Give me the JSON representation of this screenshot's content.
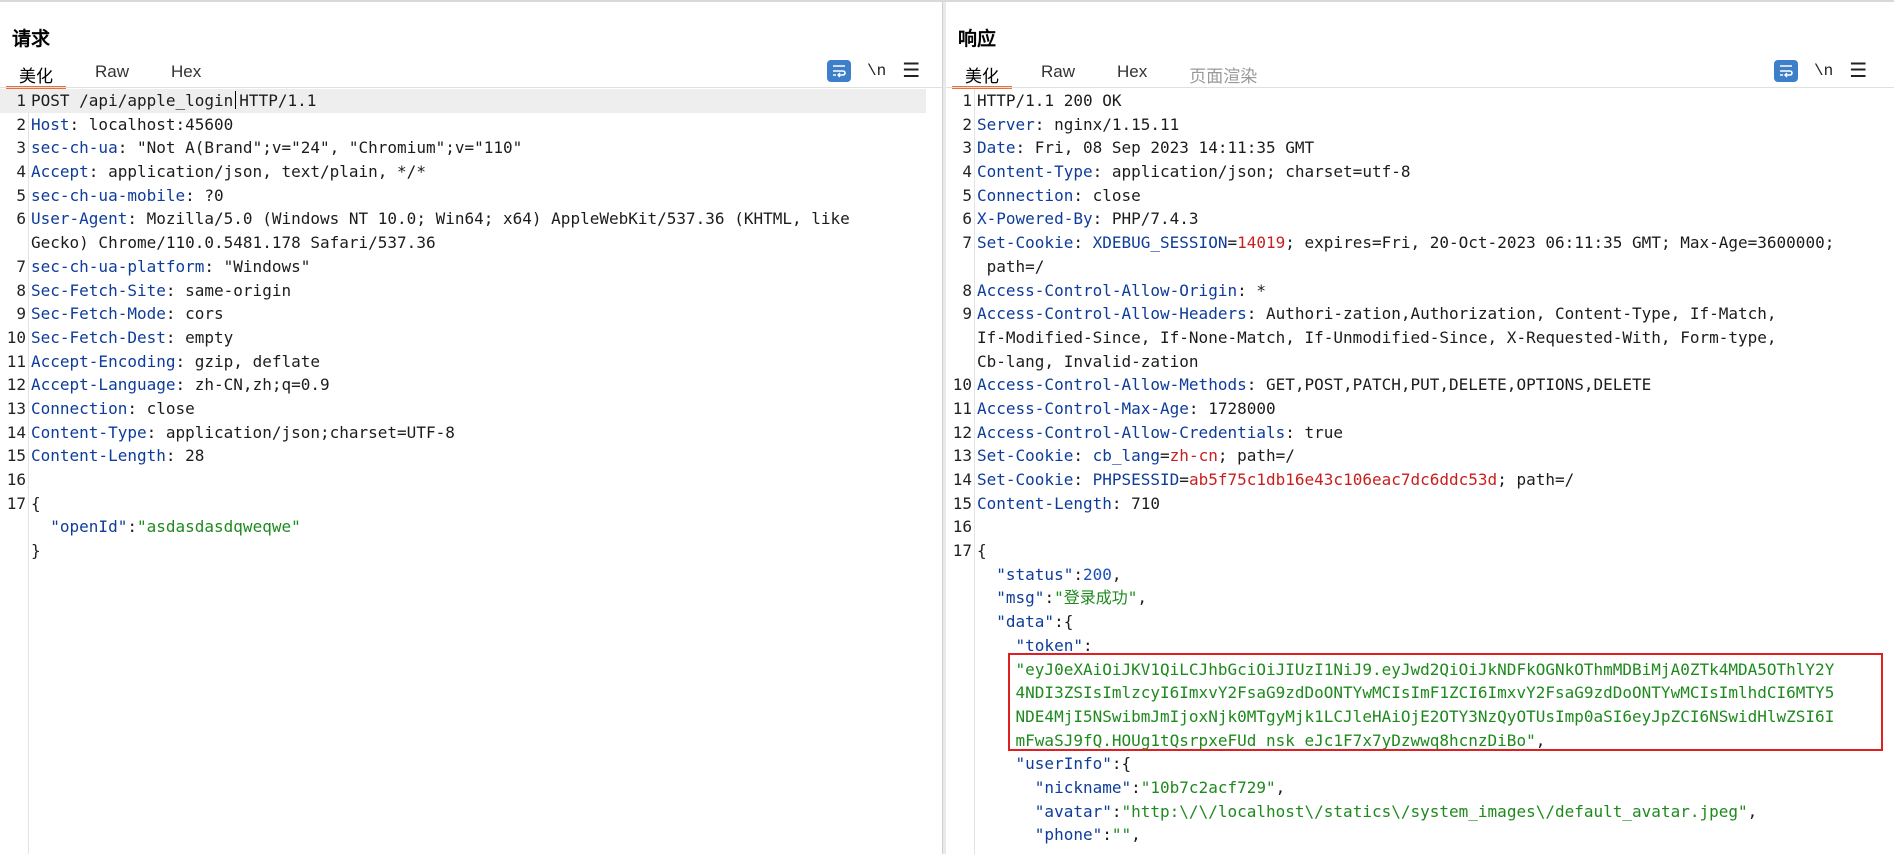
{
  "request": {
    "title": "请求",
    "tabs": [
      "美化",
      "Raw",
      "Hex"
    ],
    "active_tab": "美化",
    "tools": {
      "wrap_icon": "wrap-text-icon",
      "newline_label": "\\n",
      "menu_icon": "hamburger-menu-icon"
    },
    "lines": [
      {
        "n": "1",
        "segs": [
          [
            "hs",
            "POST /api/apple_login"
          ],
          [
            "caret",
            ""
          ],
          [
            "hs",
            "HTTP/1.1"
          ]
        ],
        "hl": true
      },
      {
        "n": "2",
        "segs": [
          [
            "hk",
            "Host"
          ],
          [
            "hs",
            ": localhost:45600"
          ]
        ]
      },
      {
        "n": "3",
        "segs": [
          [
            "hk",
            "sec-ch-ua"
          ],
          [
            "hs",
            ": \"Not A(Brand\";v=\"24\", \"Chromium\";v=\"110\""
          ]
        ]
      },
      {
        "n": "4",
        "segs": [
          [
            "hk",
            "Accept"
          ],
          [
            "hs",
            ": application/json, text/plain, */*"
          ]
        ]
      },
      {
        "n": "5",
        "segs": [
          [
            "hk",
            "sec-ch-ua-mobile"
          ],
          [
            "hs",
            ": ?0"
          ]
        ]
      },
      {
        "n": "6",
        "segs": [
          [
            "hk",
            "User-Agent"
          ],
          [
            "hs",
            ": Mozilla/5.0 (Windows NT 10.0; Win64; x64) AppleWebKit/537.36 (KHTML, like"
          ]
        ]
      },
      {
        "n": "",
        "segs": [
          [
            "hs",
            "Gecko) Chrome/110.0.5481.178 Safari/537.36"
          ]
        ]
      },
      {
        "n": "7",
        "segs": [
          [
            "hk",
            "sec-ch-ua-platform"
          ],
          [
            "hs",
            ": \"Windows\""
          ]
        ]
      },
      {
        "n": "8",
        "segs": [
          [
            "hk",
            "Sec-Fetch-Site"
          ],
          [
            "hs",
            ": same-origin"
          ]
        ]
      },
      {
        "n": "9",
        "segs": [
          [
            "hk",
            "Sec-Fetch-Mode"
          ],
          [
            "hs",
            ": cors"
          ]
        ]
      },
      {
        "n": "10",
        "segs": [
          [
            "hk",
            "Sec-Fetch-Dest"
          ],
          [
            "hs",
            ": empty"
          ]
        ]
      },
      {
        "n": "11",
        "segs": [
          [
            "hk",
            "Accept-Encoding"
          ],
          [
            "hs",
            ": gzip, deflate"
          ]
        ]
      },
      {
        "n": "12",
        "segs": [
          [
            "hk",
            "Accept-Language"
          ],
          [
            "hs",
            ": zh-CN,zh;q=0.9"
          ]
        ]
      },
      {
        "n": "13",
        "segs": [
          [
            "hk",
            "Connection"
          ],
          [
            "hs",
            ": close"
          ]
        ]
      },
      {
        "n": "14",
        "segs": [
          [
            "hk",
            "Content-Type"
          ],
          [
            "hs",
            ": application/json;charset=UTF-8"
          ]
        ]
      },
      {
        "n": "15",
        "segs": [
          [
            "hk",
            "Content-Length"
          ],
          [
            "hs",
            ": 28"
          ]
        ]
      },
      {
        "n": "16",
        "segs": []
      },
      {
        "n": "17",
        "segs": [
          [
            "hs",
            "{"
          ]
        ]
      },
      {
        "n": "",
        "segs": [
          [
            "hs",
            "  "
          ],
          [
            "jk",
            "\"openId\""
          ],
          [
            "hs",
            ":"
          ],
          [
            "js",
            "\"asdasdasdqweqwe\""
          ]
        ]
      },
      {
        "n": "",
        "segs": [
          [
            "hs",
            "}"
          ]
        ]
      }
    ]
  },
  "response": {
    "title": "响应",
    "tabs": [
      "美化",
      "Raw",
      "Hex",
      "页面渲染"
    ],
    "active_tab": "美化",
    "tools": {
      "wrap_icon": "wrap-text-icon",
      "newline_label": "\\n",
      "menu_icon": "hamburger-menu-icon"
    },
    "lines": [
      {
        "n": "1",
        "segs": [
          [
            "hs",
            "HTTP/1.1 200 OK"
          ]
        ]
      },
      {
        "n": "2",
        "segs": [
          [
            "hk",
            "Server"
          ],
          [
            "hs",
            ": nginx/1.15.11"
          ]
        ]
      },
      {
        "n": "3",
        "segs": [
          [
            "hk",
            "Date"
          ],
          [
            "hs",
            ": Fri, 08 Sep 2023 14:11:35 GMT"
          ]
        ]
      },
      {
        "n": "4",
        "segs": [
          [
            "hk",
            "Content-Type"
          ],
          [
            "hs",
            ": application/json; charset=utf-8"
          ]
        ]
      },
      {
        "n": "5",
        "segs": [
          [
            "hk",
            "Connection"
          ],
          [
            "hs",
            ": close"
          ]
        ]
      },
      {
        "n": "6",
        "segs": [
          [
            "hk",
            "X-Powered-By"
          ],
          [
            "hs",
            ": PHP/7.4.3"
          ]
        ]
      },
      {
        "n": "7",
        "segs": [
          [
            "hk",
            "Set-Cookie"
          ],
          [
            "hs",
            ": "
          ],
          [
            "sk",
            "XDEBUG_SESSION"
          ],
          [
            "hs",
            "="
          ],
          [
            "sv",
            "14019"
          ],
          [
            "hs",
            "; expires=Fri, 20-Oct-2023 06:11:35 GMT; Max-Age=3600000;"
          ]
        ]
      },
      {
        "n": "",
        "segs": [
          [
            "hs",
            " path=/"
          ]
        ]
      },
      {
        "n": "8",
        "segs": [
          [
            "hk",
            "Access-Control-Allow-Origin"
          ],
          [
            "hs",
            ": *"
          ]
        ]
      },
      {
        "n": "9",
        "segs": [
          [
            "hk",
            "Access-Control-Allow-Headers"
          ],
          [
            "hs",
            ": Authori-zation,Authorization, Content-Type, If-Match,"
          ]
        ]
      },
      {
        "n": "",
        "segs": [
          [
            "hs",
            "If-Modified-Since, If-None-Match, If-Unmodified-Since, X-Requested-With, Form-type,"
          ]
        ]
      },
      {
        "n": "",
        "segs": [
          [
            "hs",
            "Cb-lang, Invalid-zation"
          ]
        ]
      },
      {
        "n": "10",
        "segs": [
          [
            "hk",
            "Access-Control-Allow-Methods"
          ],
          [
            "hs",
            ": GET,POST,PATCH,PUT,DELETE,OPTIONS,DELETE"
          ]
        ]
      },
      {
        "n": "11",
        "segs": [
          [
            "hk",
            "Access-Control-Max-Age"
          ],
          [
            "hs",
            ": 1728000"
          ]
        ]
      },
      {
        "n": "12",
        "segs": [
          [
            "hk",
            "Access-Control-Allow-Credentials"
          ],
          [
            "hs",
            ": true"
          ]
        ]
      },
      {
        "n": "13",
        "segs": [
          [
            "hk",
            "Set-Cookie"
          ],
          [
            "hs",
            ": "
          ],
          [
            "sk",
            "cb_lang"
          ],
          [
            "hs",
            "="
          ],
          [
            "sv",
            "zh-cn"
          ],
          [
            "hs",
            "; path=/"
          ]
        ]
      },
      {
        "n": "14",
        "segs": [
          [
            "hk",
            "Set-Cookie"
          ],
          [
            "hs",
            ": "
          ],
          [
            "sk",
            "PHPSESSID"
          ],
          [
            "hs",
            "="
          ],
          [
            "sv",
            "ab5f75c1db16e43c106eac7dc6ddc53d"
          ],
          [
            "hs",
            "; path=/"
          ]
        ]
      },
      {
        "n": "15",
        "segs": [
          [
            "hk",
            "Content-Length"
          ],
          [
            "hs",
            ": 710"
          ]
        ]
      },
      {
        "n": "16",
        "segs": []
      },
      {
        "n": "17",
        "segs": [
          [
            "hs",
            "{"
          ]
        ]
      },
      {
        "n": "",
        "segs": [
          [
            "hs",
            "  "
          ],
          [
            "jk",
            "\"status\""
          ],
          [
            "hs",
            ":"
          ],
          [
            "jn",
            "200"
          ],
          [
            "hs",
            ","
          ]
        ]
      },
      {
        "n": "",
        "segs": [
          [
            "hs",
            "  "
          ],
          [
            "jk",
            "\"msg\""
          ],
          [
            "hs",
            ":"
          ],
          [
            "js",
            "\"登录成功\""
          ],
          [
            "hs",
            ","
          ]
        ]
      },
      {
        "n": "",
        "segs": [
          [
            "hs",
            "  "
          ],
          [
            "jk",
            "\"data\""
          ],
          [
            "hs",
            ":{"
          ]
        ]
      },
      {
        "n": "",
        "segs": [
          [
            "hs",
            "    "
          ],
          [
            "jk",
            "\"token\""
          ],
          [
            "hs",
            ":"
          ]
        ]
      },
      {
        "n": "",
        "segs": [
          [
            "hs",
            "    "
          ],
          [
            "js",
            "\"eyJ0eXAiOiJKV1QiLCJhbGciOiJIUzI1NiJ9.eyJwd2QiOiJkNDFkOGNkOThmMDBiMjA0ZTk4MDA5OThlY2Y"
          ]
        ]
      },
      {
        "n": "",
        "segs": [
          [
            "hs",
            "    "
          ],
          [
            "js",
            "4NDI3ZSIsImlzcyI6ImxvY2FsaG9zdDoONTYwMCIsImF1ZCI6ImxvY2FsaG9zdDoONTYwMCIsImlhdCI6MTY5"
          ]
        ]
      },
      {
        "n": "",
        "segs": [
          [
            "hs",
            "    "
          ],
          [
            "js",
            "NDE4MjI5NSwibmJmIjoxNjk0MTgyMjk1LCJleHAiOjE2OTY3NzQyOTUsImp0aSI6eyJpZCI6NSwidHlwZSI6I"
          ]
        ]
      },
      {
        "n": "",
        "segs": [
          [
            "hs",
            "    "
          ],
          [
            "js",
            "mFwaSJ9fQ.HOUg1tQsrpxeFUd_nsk_eJc1F7x7yDzwwq8hcnzDiBo\""
          ],
          [
            "hs",
            ","
          ]
        ]
      },
      {
        "n": "",
        "segs": [
          [
            "hs",
            "    "
          ],
          [
            "jk",
            "\"userInfo\""
          ],
          [
            "hs",
            ":{"
          ]
        ]
      },
      {
        "n": "",
        "segs": [
          [
            "hs",
            "      "
          ],
          [
            "jk",
            "\"nickname\""
          ],
          [
            "hs",
            ":"
          ],
          [
            "js",
            "\"10b7c2acf729\""
          ],
          [
            "hs",
            ","
          ]
        ]
      },
      {
        "n": "",
        "segs": [
          [
            "hs",
            "      "
          ],
          [
            "jk",
            "\"avatar\""
          ],
          [
            "hs",
            ":"
          ],
          [
            "js",
            "\"http:\\/\\/localhost\\/statics\\/system_images\\/default_avatar.jpeg\""
          ],
          [
            "hs",
            ","
          ]
        ]
      },
      {
        "n": "",
        "segs": [
          [
            "hs",
            "      "
          ],
          [
            "jk",
            "\"phone\""
          ],
          [
            "hs",
            ":"
          ],
          [
            "js",
            "\"\""
          ],
          [
            "hs",
            ","
          ]
        ]
      }
    ]
  },
  "layout_buttons": {
    "icons": [
      "split-columns-icon",
      "split-rows-icon",
      "single-pane-icon"
    ],
    "active": 0
  },
  "colors": {
    "accent_tab": "#e8703a",
    "header_key": "#0e3c9a",
    "cookie_value": "#c81e1e",
    "json_string": "#1e8a1e",
    "json_number": "#1a4fc4",
    "highlight_box": "#e02020",
    "button_blue": "#3d7fc9"
  }
}
